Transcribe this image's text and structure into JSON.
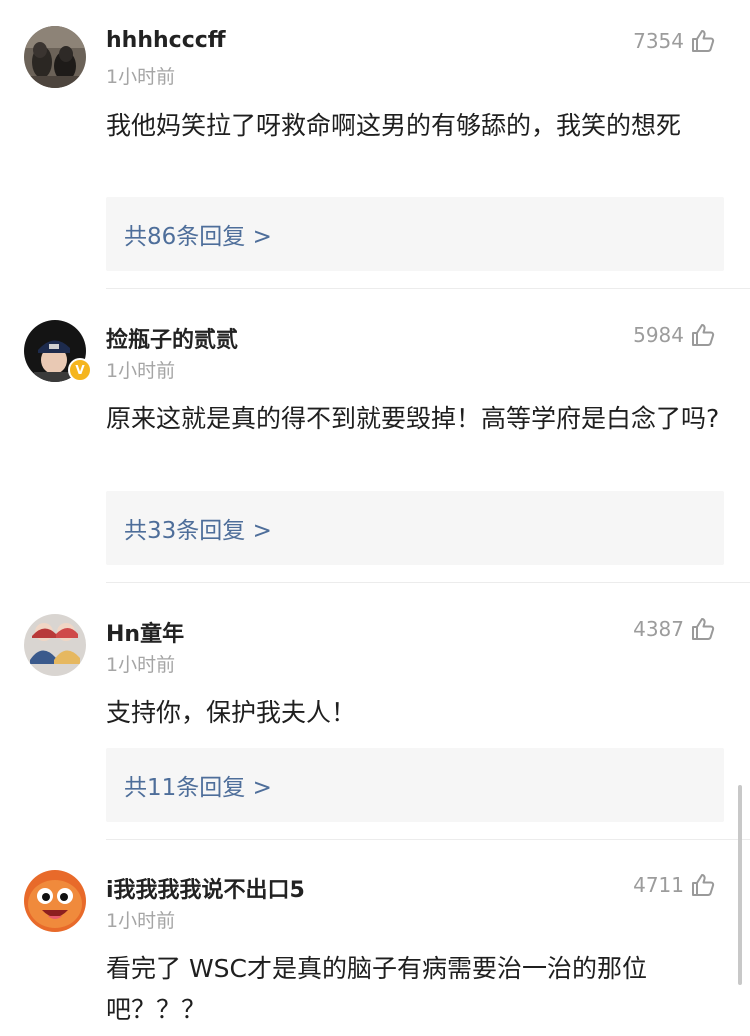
{
  "comments": [
    {
      "username": "hhhhcccff",
      "time": "1小时前",
      "likes": "7354",
      "text": "我他妈笑拉了呀救命啊这男的有够舔的，我笑的想死",
      "replies_label": "共86条回复 >"
    },
    {
      "username": "捡瓶子的贰贰",
      "time": "1小时前",
      "likes": "5984",
      "text": "原来这就是真的得不到就要毁掉！高等学府是白念了吗?",
      "replies_label": "共33条回复 >",
      "verified_badge": "V"
    },
    {
      "username": "Hn童年",
      "time": "1小时前",
      "likes": "4387",
      "text": "支持你，保护我夫人！",
      "replies_label": "共11条回复 >"
    },
    {
      "username": "i我我我我说不出口5",
      "time": "1小时前",
      "likes": "4711",
      "text": "看完了 WSC才是真的脑子有病需要治一治的那位吧？？？"
    }
  ],
  "colors": {
    "reply_link": "#4e6e9a",
    "reply_background": "#f6f6f6",
    "timestamp": "#a5a5a5",
    "like_count": "#9c9c9c",
    "verified_badge": "#f5b51d"
  },
  "icons": {
    "like": "thumbs-up-outline-icon"
  }
}
